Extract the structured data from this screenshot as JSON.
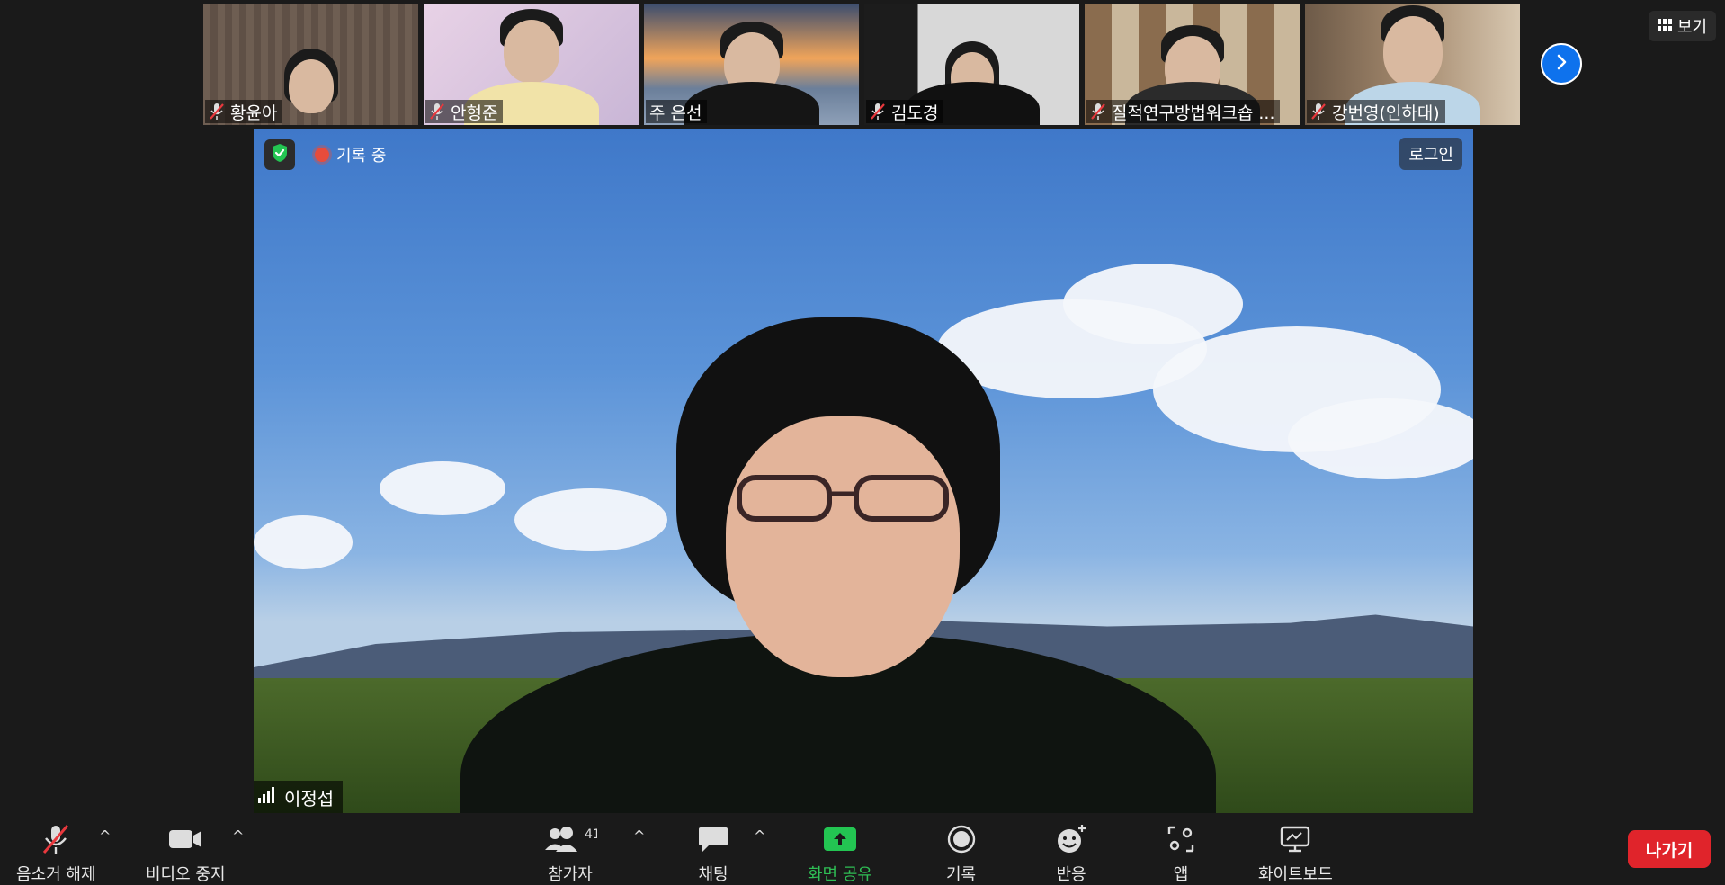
{
  "thumbnails": [
    {
      "name": "황윤아",
      "muted": true
    },
    {
      "name": "안형준",
      "muted": true
    },
    {
      "name": "주 은선",
      "muted": false
    },
    {
      "name": "김도경",
      "muted": true
    },
    {
      "name": "질적연구방법워크숍 ...",
      "muted": true
    },
    {
      "name": "강번영(인하대)",
      "muted": true
    }
  ],
  "view_button": {
    "label": "보기"
  },
  "main": {
    "recording_label": "기록 중",
    "login_label": "로그인",
    "speaker_name": "이정섭"
  },
  "toolbar": {
    "unmute_label": "음소거 해제",
    "stop_video_label": "비디오 중지",
    "participants_label": "참가자",
    "participants_count": "41",
    "chat_label": "채팅",
    "share_label": "화면 공유",
    "record_label": "기록",
    "reactions_label": "반응",
    "apps_label": "앱",
    "whiteboard_label": "화이트보드",
    "leave_label": "나가기"
  },
  "colors": {
    "background": "#1a1a1a",
    "share_green": "#2fbf55",
    "leave_red": "#e0242b",
    "accent_blue": "#0e72ed",
    "muted_red": "#e8383d"
  },
  "icons": [
    "microphone-muted-icon",
    "camera-icon",
    "participants-icon",
    "chat-icon",
    "share-screen-icon",
    "record-icon",
    "reaction-icon",
    "apps-icon",
    "whiteboard-icon",
    "shield-icon",
    "grid-icon",
    "chevron-right-icon",
    "signal-icon"
  ]
}
